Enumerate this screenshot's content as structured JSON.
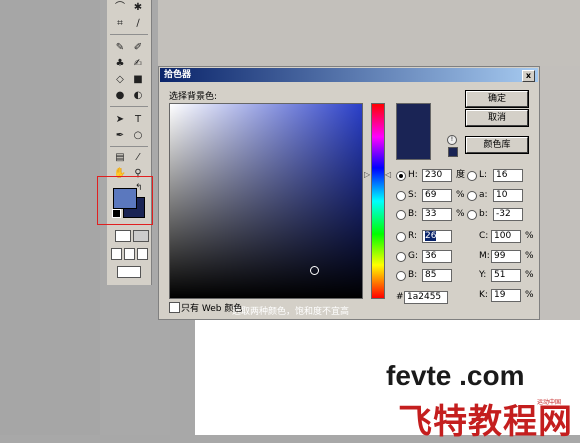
{
  "dialog": {
    "title": "拾色器",
    "close_glyph": "x",
    "prompt": "选择背景色:",
    "field_caption": "选取两种颜色，饱和度不宜高",
    "buttons": {
      "ok": "确定",
      "cancel": "取消",
      "libraries": "颜色库"
    },
    "hsb": {
      "h": {
        "label": "H:",
        "value": "230",
        "unit": "度"
      },
      "s": {
        "label": "S:",
        "value": "69",
        "unit": "%"
      },
      "b": {
        "label": "B:",
        "value": "33",
        "unit": "%"
      }
    },
    "rgb": {
      "r": {
        "label": "R:",
        "value": "26"
      },
      "g": {
        "label": "G:",
        "value": "36"
      },
      "b": {
        "label": "B:",
        "value": "85"
      }
    },
    "lab": {
      "l": {
        "label": "L:",
        "value": "16"
      },
      "a": {
        "label": "a:",
        "value": "10"
      },
      "b": {
        "label": "b:",
        "value": "-32"
      }
    },
    "cmyk": {
      "c": {
        "label": "C:",
        "value": "100",
        "unit": "%"
      },
      "m": {
        "label": "M:",
        "value": "99",
        "unit": "%"
      },
      "y": {
        "label": "Y:",
        "value": "51",
        "unit": "%"
      },
      "k": {
        "label": "K:",
        "value": "19",
        "unit": "%"
      }
    },
    "hex": {
      "label": "#",
      "value": "1a2455"
    },
    "web_only": {
      "label": "只有 Web 颜色",
      "checked": false
    },
    "selected_mode": "H",
    "current_color": "#1a2455"
  },
  "toolbox": {
    "foreground_color": "#5b78be",
    "background_color": "#1a2455",
    "highlight_color": "#e02020"
  },
  "watermark": {
    "site": "fevte .com",
    "brand": "飞特教程网",
    "small": "运动中国"
  }
}
